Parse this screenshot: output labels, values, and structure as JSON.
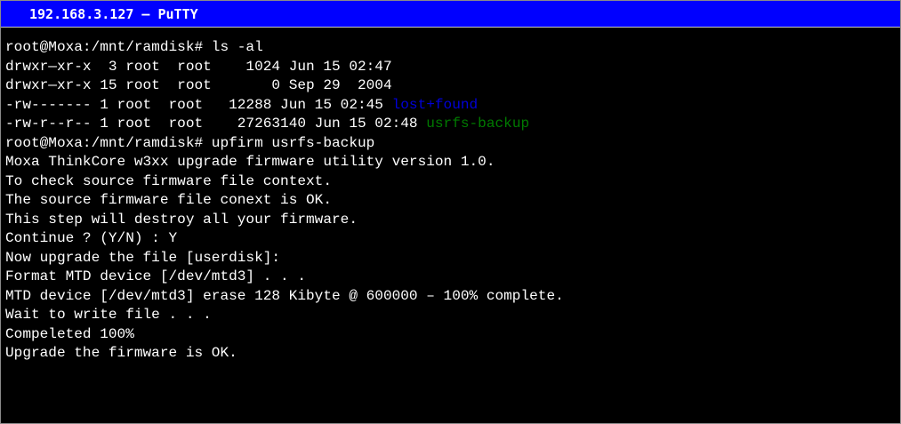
{
  "window": {
    "title": "192.168.3.127 – PuTTY"
  },
  "terminal": {
    "lines": [
      {
        "text": "root@Moxa:/mnt/ramdisk# ls -al"
      },
      {
        "text": "drwxr—xr-x  3 root  root    1024 Jun 15 02:47"
      },
      {
        "text": "drwxr—xr-x 15 root  root       0 Sep 29  2004"
      },
      {
        "text": "-rw------- 1 root  root   12288 Jun 15 02:45 ",
        "highlight": "lost+found",
        "highlight_color": "#0000d8"
      },
      {
        "text": "-rw-r--r-- 1 root  root    27263140 Jun 15 02:48 ",
        "highlight": "usrfs-backup",
        "highlight_color": "#007a00"
      },
      {
        "text": "root@Moxa:/mnt/ramdisk# upfirm usrfs-backup"
      },
      {
        "text": "Moxa ThinkCore w3xx upgrade firmware utility version 1.0."
      },
      {
        "text": "To check source firmware file context."
      },
      {
        "text": "The source firmware file conext is OK."
      },
      {
        "text": "This step will destroy all your firmware."
      },
      {
        "text": "Continue ? (Y/N) : Y"
      },
      {
        "text": "Now upgrade the file [userdisk]:"
      },
      {
        "text": "Format MTD device [/dev/mtd3] . . ."
      },
      {
        "text": "MTD device [/dev/mtd3] erase 128 Kibyte @ 600000 – 100% complete."
      },
      {
        "text": "Wait to write file . . ."
      },
      {
        "text": "Compeleted 100%"
      },
      {
        "text": "Upgrade the firmware is OK."
      }
    ]
  },
  "colors": {
    "titlebar": "#0000ff",
    "terminal_bg": "#000000",
    "terminal_fg": "#ffffff",
    "directory": "#0000d8",
    "file": "#007a00"
  }
}
